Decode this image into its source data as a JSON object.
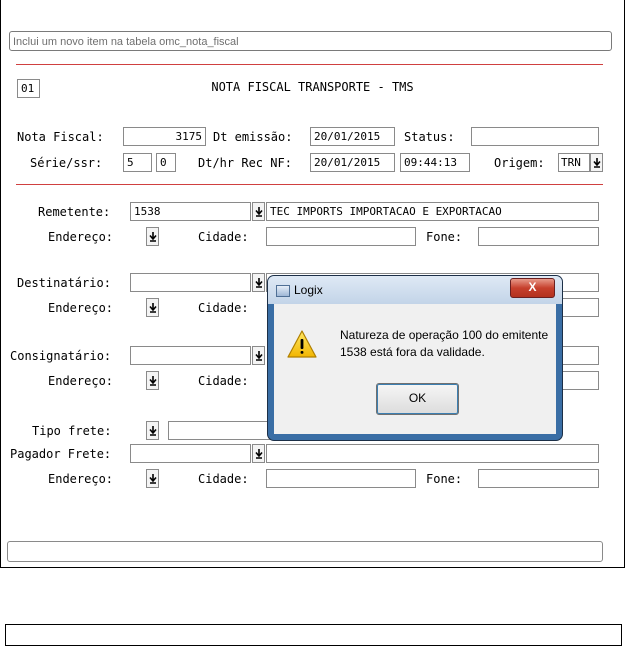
{
  "form": {
    "hint": "Inclui um novo item na tabela omc_nota_fiscal",
    "code": "01",
    "title": "NOTA FISCAL TRANSPORTE - TMS",
    "nota_fiscal_label": "Nota Fiscal:",
    "nota_fiscal_value": "3175",
    "dt_emissao_label": "Dt emissão:",
    "dt_emissao_value": "20/01/2015",
    "status_label": "Status:",
    "status_value": "",
    "serie_label": "Série/ssr:",
    "serie_value": "5",
    "ssr_value": "0",
    "dt_rec_label": "Dt/hr Rec NF:",
    "dt_rec_date": "20/01/2015",
    "dt_rec_time": "09:44:13",
    "origem_label": "Origem:",
    "origem_value": "TRN",
    "remetente_label": "Remetente:",
    "remetente_code": "1538",
    "remetente_name": "TEC IMPORTS IMPORTACAO E EXPORTACAO",
    "endereco_label": "Endereço:",
    "cidade_label": "Cidade:",
    "fone_label": "Fone:",
    "destinatario_label": "Destinatário:",
    "consignatario_label": "Consignatário:",
    "tipo_frete_label": "Tipo frete:",
    "pagador_label": "Pagador Frete:"
  },
  "dialog": {
    "title": "Logix",
    "close_label": "X",
    "message": "Natureza de operação 100 do emitente 1538 está fora da validade.",
    "ok_label": "OK"
  },
  "icons": {
    "dropdown": "arrow-down-icon",
    "warning": "warning-icon",
    "app": "window-icon"
  },
  "colors": {
    "separator": "#d04040",
    "dialog_frame": "#3a6ea5",
    "close_button": "#c6402d"
  }
}
